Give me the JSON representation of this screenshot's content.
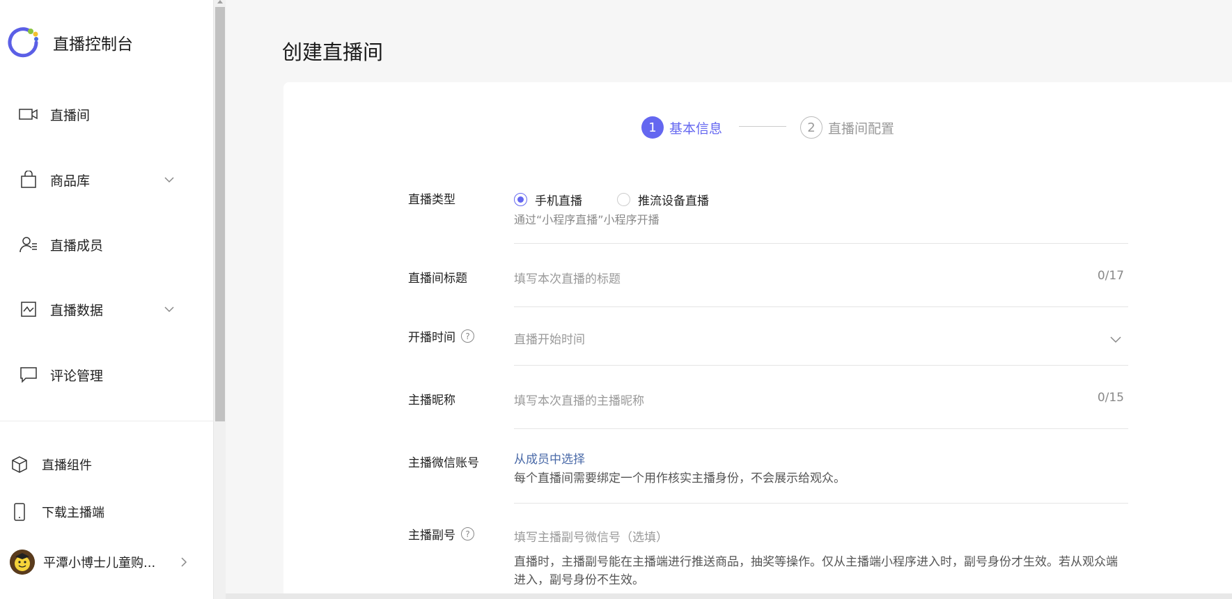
{
  "app": {
    "title": "直播控制台"
  },
  "sidebar": {
    "items": [
      {
        "label": "直播间",
        "icon": "video-camera-icon"
      },
      {
        "label": "商品库",
        "icon": "shopping-bag-icon"
      },
      {
        "label": "直播成员",
        "icon": "member-icon"
      },
      {
        "label": "直播数据",
        "icon": "chart-icon"
      },
      {
        "label": "评论管理",
        "icon": "comment-icon"
      }
    ],
    "bottom": [
      {
        "label": "直播组件",
        "icon": "cube-icon"
      },
      {
        "label": "下载主播端",
        "icon": "phone-icon"
      }
    ],
    "account": {
      "label": "平潭小博士儿童购..."
    }
  },
  "page": {
    "title": "创建直播间"
  },
  "stepper": {
    "steps": [
      {
        "num": "1",
        "label": "基本信息"
      },
      {
        "num": "2",
        "label": "直播间配置"
      }
    ]
  },
  "form": {
    "live_type": {
      "label": "直播类型",
      "options": [
        "手机直播",
        "推流设备直播"
      ],
      "selected": "手机直播",
      "hint": "通过“小程序直播”小程序开播"
    },
    "room_title": {
      "label": "直播间标题",
      "placeholder": "填写本次直播的标题",
      "counter": "0/17"
    },
    "start_time": {
      "label": "开播时间",
      "placeholder": "直播开始时间"
    },
    "anchor_nickname": {
      "label": "主播昵称",
      "placeholder": "填写本次直播的主播昵称",
      "counter": "0/15"
    },
    "anchor_wechat": {
      "label": "主播微信账号",
      "link": "从成员中选择",
      "hint": "每个直播间需要绑定一个用作核实主播身份，不会展示给观众。"
    },
    "sub_anchor": {
      "label": "主播副号",
      "placeholder": "填写主播副号微信号（选填）",
      "hint_line1": "直播时，主播副号能在主播端进行推送商品，抽奖等操作。仅从主播端小程序进入时，副号身份才生效。若从观众端",
      "hint_line2": "进入，副号身份不生效。"
    }
  },
  "colors": {
    "accent": "#6467f0",
    "link": "#4a6aa8"
  }
}
